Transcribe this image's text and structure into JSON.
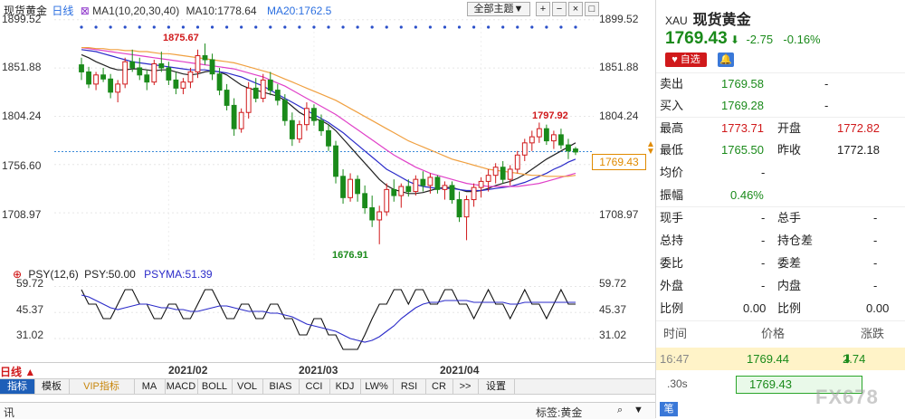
{
  "main_header": {
    "title": "现货黄金",
    "period": "日线",
    "ma_label": "MA1(10,20,30,40)",
    "ma10_label": "MA10:1778.64",
    "ma20_label": "MA20:1762.5",
    "theme_button": "全部主题▼"
  },
  "price_axis": [
    "1899.52",
    "1851.88",
    "1804.24",
    "1756.60",
    "1708.97"
  ],
  "price_axis_right": [
    "1899.52",
    "1851.88",
    "1804.24",
    "1708.97"
  ],
  "current_price_tag": "1769.43",
  "annotations": {
    "high": "1875.67",
    "low": "1676.91",
    "recent_high": "1797.92"
  },
  "psy_header": {
    "label": "PSY(12,6)",
    "psy": "PSY:50.00",
    "psyma": "PSYMA:51.39"
  },
  "psy_axis": [
    "59.72",
    "45.37",
    "31.02"
  ],
  "date_axis": [
    "2021/02",
    "2021/03",
    "2021/04"
  ],
  "period_bar": {
    "label": "日线"
  },
  "tabs": [
    "指标",
    "模板",
    "VIP指标",
    "MA",
    "MACD",
    "BOLL",
    "VOL",
    "BIAS",
    "CCI",
    "KDJ",
    "LW%",
    "RSI",
    "CR",
    ">>",
    "设置"
  ],
  "status_bar": {
    "left": "讯",
    "mid": "标签:黄金"
  },
  "right_panel": {
    "code": "XAU",
    "name": "现货黄金",
    "price": "1769.43",
    "arrow": "⬇",
    "change": "-2.75",
    "change_pct": "-0.16%",
    "btn_watch": "自选",
    "sell_label": "卖出",
    "sell_value": "1769.58",
    "sell_extra": "-",
    "buy_label": "买入",
    "buy_value": "1769.28",
    "buy_extra": "-",
    "high_label": "最高",
    "high_value": "1773.71",
    "open_label": "开盘",
    "open_value": "1772.82",
    "low_label": "最低",
    "low_value": "1765.50",
    "prev_label": "昨收",
    "prev_value": "1772.18",
    "avg_label": "均价",
    "avg_value": "-",
    "amp_label": "振幅",
    "amp_value": "0.46%",
    "vol_label": "现手",
    "vol_value": "-",
    "total_label": "总手",
    "total_value": "-",
    "hold_label": "总持",
    "hold_value": "-",
    "holdchg_label": "持仓差",
    "holdchg_value": "-",
    "bidratio_label": "委比",
    "bidratio_value": "-",
    "biddiff_label": "委差",
    "biddiff_value": "-",
    "outer_label": "外盘",
    "outer_value": "-",
    "inner_label": "内盘",
    "inner_value": "-",
    "ratio1_label": "比例",
    "ratio1_value": "0.00",
    "ratio2_label": "比例",
    "ratio2_value": "0.00",
    "tick_h_time": "时间",
    "tick_h_price": "价格",
    "tick_h_change": "涨跌",
    "tick_time": "16:47",
    "tick_price": "1769.44",
    "tick_change": "2.74",
    "tick2_time": ".30s",
    "tick2_price": "1769.43",
    "bottom_btn": "笔",
    "watermark": "FX678"
  },
  "chart_data": {
    "type": "candlestick",
    "title": "现货黄金",
    "ylim": [
      1660,
      1910
    ],
    "x_ticks": [
      "2021/02",
      "2021/03",
      "2021/04"
    ],
    "candles": [
      [
        1855,
        1862,
        1840,
        1848
      ],
      [
        1848,
        1853,
        1832,
        1836
      ],
      [
        1836,
        1848,
        1830,
        1845
      ],
      [
        1845,
        1852,
        1838,
        1841
      ],
      [
        1841,
        1846,
        1822,
        1828
      ],
      [
        1828,
        1840,
        1818,
        1836
      ],
      [
        1836,
        1862,
        1832,
        1858
      ],
      [
        1858,
        1870,
        1848,
        1852
      ],
      [
        1852,
        1862,
        1840,
        1845
      ],
      [
        1845,
        1850,
        1830,
        1838
      ],
      [
        1838,
        1860,
        1835,
        1856
      ],
      [
        1856,
        1868,
        1848,
        1852
      ],
      [
        1852,
        1858,
        1835,
        1840
      ],
      [
        1840,
        1848,
        1826,
        1832
      ],
      [
        1832,
        1842,
        1826,
        1838
      ],
      [
        1838,
        1852,
        1832,
        1848
      ],
      [
        1848,
        1870,
        1842,
        1864
      ],
      [
        1864,
        1876,
        1855,
        1860
      ],
      [
        1860,
        1866,
        1840,
        1846
      ],
      [
        1846,
        1852,
        1825,
        1830
      ],
      [
        1830,
        1836,
        1810,
        1815
      ],
      [
        1815,
        1822,
        1785,
        1792
      ],
      [
        1792,
        1812,
        1788,
        1808
      ],
      [
        1808,
        1838,
        1802,
        1832
      ],
      [
        1832,
        1842,
        1818,
        1822
      ],
      [
        1822,
        1846,
        1818,
        1840
      ],
      [
        1840,
        1848,
        1825,
        1830
      ],
      [
        1830,
        1836,
        1815,
        1820
      ],
      [
        1820,
        1826,
        1795,
        1800
      ],
      [
        1800,
        1808,
        1775,
        1782
      ],
      [
        1782,
        1800,
        1778,
        1796
      ],
      [
        1796,
        1818,
        1790,
        1812
      ],
      [
        1812,
        1816,
        1795,
        1800
      ],
      [
        1800,
        1806,
        1785,
        1790
      ],
      [
        1790,
        1796,
        1770,
        1775
      ],
      [
        1775,
        1780,
        1738,
        1745
      ],
      [
        1745,
        1752,
        1718,
        1724
      ],
      [
        1724,
        1748,
        1720,
        1742
      ],
      [
        1742,
        1746,
        1720,
        1728
      ],
      [
        1728,
        1736,
        1708,
        1714
      ],
      [
        1714,
        1726,
        1695,
        1702
      ],
      [
        1702,
        1716,
        1678,
        1710
      ],
      [
        1710,
        1738,
        1706,
        1732
      ],
      [
        1732,
        1742,
        1720,
        1726
      ],
      [
        1726,
        1738,
        1714,
        1735
      ],
      [
        1735,
        1742,
        1725,
        1730
      ],
      [
        1730,
        1746,
        1726,
        1742
      ],
      [
        1742,
        1750,
        1730,
        1736
      ],
      [
        1736,
        1748,
        1728,
        1744
      ],
      [
        1744,
        1746,
        1728,
        1732
      ],
      [
        1732,
        1740,
        1722,
        1736
      ],
      [
        1736,
        1740,
        1718,
        1722
      ],
      [
        1722,
        1730,
        1700,
        1705
      ],
      [
        1705,
        1726,
        1682,
        1722
      ],
      [
        1722,
        1738,
        1715,
        1734
      ],
      [
        1734,
        1744,
        1724,
        1740
      ],
      [
        1740,
        1752,
        1730,
        1746
      ],
      [
        1746,
        1758,
        1738,
        1754
      ],
      [
        1754,
        1760,
        1738,
        1742
      ],
      [
        1742,
        1756,
        1736,
        1752
      ],
      [
        1752,
        1770,
        1748,
        1766
      ],
      [
        1766,
        1782,
        1760,
        1778
      ],
      [
        1778,
        1790,
        1770,
        1784
      ],
      [
        1784,
        1798,
        1778,
        1792
      ],
      [
        1792,
        1796,
        1776,
        1780
      ],
      [
        1780,
        1790,
        1772,
        1786
      ],
      [
        1786,
        1792,
        1772,
        1776
      ],
      [
        1776,
        1782,
        1762,
        1770
      ],
      [
        1772,
        1774,
        1766,
        1769
      ]
    ],
    "ma10": [
      1865,
      1862,
      1858,
      1855,
      1852,
      1850,
      1850,
      1851,
      1851,
      1850,
      1849,
      1850,
      1850,
      1848,
      1846,
      1845,
      1846,
      1848,
      1849,
      1848,
      1845,
      1840,
      1835,
      1832,
      1830,
      1828,
      1826,
      1824,
      1820,
      1814,
      1808,
      1804,
      1802,
      1800,
      1796,
      1790,
      1782,
      1774,
      1766,
      1758,
      1750,
      1742,
      1736,
      1732,
      1730,
      1728,
      1728,
      1729,
      1731,
      1733,
      1734,
      1734,
      1732,
      1730,
      1730,
      1731,
      1733,
      1736,
      1738,
      1740,
      1743,
      1747,
      1752,
      1757,
      1762,
      1766,
      1770,
      1774,
      1778
    ],
    "ma20": [
      1870,
      1869,
      1868,
      1866,
      1864,
      1862,
      1860,
      1858,
      1857,
      1856,
      1855,
      1854,
      1853,
      1852,
      1851,
      1850,
      1850,
      1850,
      1849,
      1848,
      1847,
      1845,
      1843,
      1840,
      1837,
      1834,
      1830,
      1826,
      1822,
      1818,
      1814,
      1810,
      1806,
      1802,
      1798,
      1793,
      1788,
      1782,
      1776,
      1770,
      1764,
      1758,
      1752,
      1748,
      1744,
      1740,
      1737,
      1735,
      1734,
      1733,
      1733,
      1733,
      1732,
      1731,
      1731,
      1731,
      1732,
      1733,
      1734,
      1735,
      1737,
      1739,
      1742,
      1745,
      1748,
      1752,
      1755,
      1759,
      1762
    ],
    "ma30": [
      1872,
      1871,
      1870,
      1869,
      1868,
      1867,
      1866,
      1865,
      1864,
      1863,
      1862,
      1861,
      1860,
      1859,
      1858,
      1857,
      1856,
      1855,
      1854,
      1853,
      1852,
      1851,
      1849,
      1847,
      1845,
      1843,
      1840,
      1837,
      1834,
      1830,
      1826,
      1822,
      1818,
      1814,
      1810,
      1806,
      1801,
      1796,
      1791,
      1786,
      1781,
      1776,
      1771,
      1766,
      1762,
      1758,
      1754,
      1751,
      1748,
      1746,
      1744,
      1742,
      1740,
      1738,
      1737,
      1736,
      1735,
      1735,
      1735,
      1735,
      1735,
      1736,
      1737,
      1738,
      1740,
      1742,
      1744,
      1746,
      1748
    ],
    "ma40": [
      1872,
      1872,
      1871,
      1871,
      1870,
      1870,
      1869,
      1869,
      1868,
      1868,
      1867,
      1866,
      1866,
      1865,
      1864,
      1863,
      1862,
      1861,
      1860,
      1859,
      1858,
      1857,
      1855,
      1853,
      1851,
      1849,
      1847,
      1844,
      1841,
      1838,
      1835,
      1832,
      1829,
      1826,
      1823,
      1820,
      1816,
      1812,
      1808,
      1804,
      1800,
      1796,
      1792,
      1788,
      1784,
      1780,
      1777,
      1774,
      1771,
      1768,
      1765,
      1762,
      1760,
      1758,
      1756,
      1754,
      1752,
      1751,
      1750,
      1749,
      1748,
      1747,
      1746,
      1746,
      1745,
      1745,
      1745,
      1745,
      1746
    ],
    "psy": [
      58,
      50,
      50,
      42,
      42,
      50,
      58,
      58,
      50,
      50,
      42,
      42,
      50,
      50,
      42,
      42,
      50,
      58,
      58,
      50,
      42,
      42,
      50,
      50,
      42,
      42,
      50,
      50,
      42,
      42,
      33,
      33,
      42,
      42,
      33,
      33,
      25,
      25,
      25,
      33,
      42,
      50,
      50,
      58,
      58,
      50,
      58,
      58,
      50,
      50,
      58,
      58,
      50,
      50,
      42,
      50,
      58,
      50,
      50,
      42,
      50,
      58,
      50,
      50,
      42,
      50,
      58,
      50,
      50
    ],
    "psyma": [
      55,
      54,
      52,
      50,
      48,
      47,
      48,
      49,
      50,
      50,
      49,
      48,
      48,
      47,
      47,
      46,
      46,
      47,
      48,
      49,
      49,
      48,
      47,
      46,
      46,
      46,
      45,
      45,
      44,
      43,
      41,
      39,
      38,
      37,
      36,
      35,
      33,
      31,
      30,
      29,
      30,
      32,
      35,
      38,
      42,
      45,
      48,
      50,
      51,
      51,
      52,
      52,
      52,
      52,
      51,
      51,
      51,
      51,
      51,
      50,
      50,
      51,
      51,
      51,
      51,
      51,
      51,
      51,
      51
    ],
    "psy_ylim": [
      20,
      65
    ]
  }
}
